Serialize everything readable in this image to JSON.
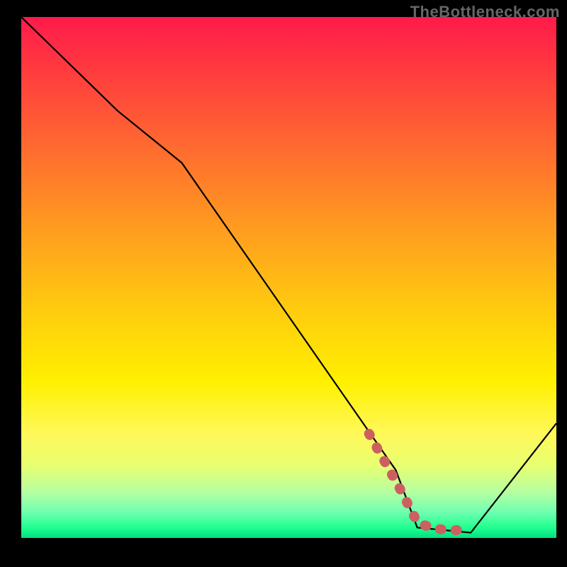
{
  "watermark": "TheBottleneck.com",
  "chart_data": {
    "type": "line",
    "title": "",
    "xlabel": "",
    "ylabel": "",
    "xlim": [
      0,
      100
    ],
    "ylim": [
      0,
      100
    ],
    "series": [
      {
        "name": "curve",
        "x": [
          0,
          18,
          30,
          70,
          74,
          84,
          100
        ],
        "y": [
          100,
          82,
          72,
          13,
          2,
          1,
          22
        ],
        "color": "#000000"
      },
      {
        "name": "highlight",
        "x": [
          65,
          71,
          74,
          77,
          80,
          82,
          84
        ],
        "y": [
          20,
          9,
          3,
          1.8,
          1.5,
          1.5,
          1.5
        ],
        "color": "#cc6060",
        "style": "dotted-thick"
      }
    ],
    "background_gradient": {
      "top_color": "#ff1a4a",
      "bottom_color": "#00e080",
      "stops": [
        "red",
        "orange",
        "yellow",
        "green"
      ]
    }
  }
}
